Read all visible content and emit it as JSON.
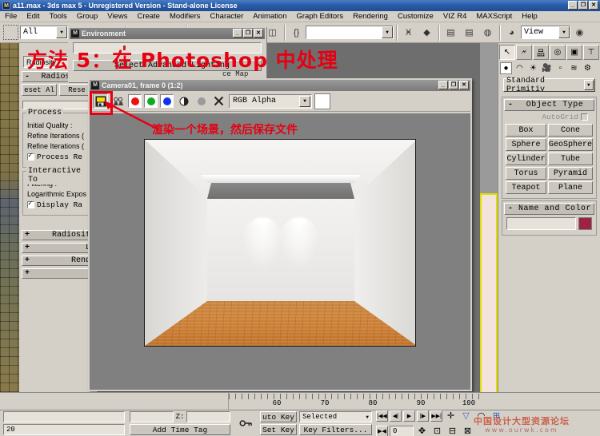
{
  "window": {
    "title": "a11.max - 3ds max 5 - Unregistered Version - Stand-alone License",
    "app_icon": "max-icon",
    "minimize": "_",
    "restore": "❐",
    "close": "✕"
  },
  "menu": {
    "items": [
      "File",
      "Edit",
      "Tools",
      "Group",
      "Views",
      "Create",
      "Modifiers",
      "Character",
      "Animation",
      "Graph Editors",
      "Rendering",
      "Customize",
      "VIZ R4",
      "MAXScript",
      "Help"
    ]
  },
  "toolbar": {
    "selection_filter": "All",
    "named_selection_sets": "",
    "view_dropdown": "View",
    "icons": [
      "undo-icon",
      "redo-icon",
      "select-link-icon",
      "unlink-icon",
      "bind-space-warp-icon",
      "select-object-icon",
      "select-by-name-icon",
      "select-region-icon",
      "move-icon",
      "rotate-icon",
      "scale-icon",
      "reference-coordinate-icon",
      "use-center-icon",
      "mirror-icon",
      "align-icon",
      "layer-manager-icon",
      "curve-editor-icon",
      "schematic-view-icon",
      "material-editor-icon",
      "render-scene-icon",
      "quick-render-icon"
    ]
  },
  "environment_dialog": {
    "title": "Environment",
    "icon": "max-icon",
    "minimize": "_",
    "restore": "❐",
    "close": "✕",
    "rollout": "Select Advanced Lighting",
    "rollout_toggle": "-",
    "stray_label": "ce Map"
  },
  "radiosity_panel": {
    "combo_value": "Radiosity",
    "rollout_title": "Radiosity",
    "rollout_toggle": "-",
    "buttons": [
      "eset Al",
      "Rese"
    ],
    "process_group": {
      "title": "Process",
      "rows": [
        "Initial Quality :",
        "Refine Iterations (",
        "Refine Iterations ("
      ],
      "checkbox_label": "Process Re",
      "checkbox_checked": true
    },
    "interactive_group": {
      "title": "Interactive To",
      "rows": [
        "Filtering :",
        "Logarithmic Expos"
      ],
      "checkbox_label": "Display Ra",
      "checkbox_checked": true
    },
    "collapsed_rollouts": [
      "Radiosit",
      "L",
      "Rend",
      ""
    ],
    "collapsed_toggle": "+"
  },
  "render_window": {
    "title": "Camera01, frame 0 (1:2)",
    "icon": "max-icon",
    "minimize": "_",
    "restore": "❐",
    "close": "✕",
    "toolbar": {
      "save_icon": "save-bitmap-icon",
      "clone_icon": "clone-rendered-frame-icon",
      "red_channel": "red-channel-icon",
      "green_channel": "green-channel-icon",
      "blue_channel": "blue-channel-icon",
      "mono_channel": "monochrome-icon",
      "alpha_channel": "alpha-channel-icon",
      "clear_icon": "clear-icon",
      "channel_dropdown": "RGB Alpha",
      "color_swatch": "#ffffff"
    },
    "colors": {
      "red": "#ee1111",
      "green": "#11aa22",
      "blue": "#1133ee"
    },
    "image": {
      "description": "rendered-interior-room",
      "floor_color": "#cf8a45",
      "wall_color": "#efeeec",
      "cove_color": "#7f7f7f",
      "spotlight_count": 2
    }
  },
  "command_panel": {
    "tabs": [
      "create-tab",
      "modify-tab",
      "hierarchy-tab",
      "motion-tab",
      "display-tab",
      "utilities-tab"
    ],
    "active_tab": 0,
    "subtabs": [
      "geometry-icon",
      "shapes-icon",
      "lights-icon",
      "cameras-icon",
      "helpers-icon",
      "space-warps-icon",
      "systems-icon"
    ],
    "category": "Standard Primitiv",
    "object_type": {
      "title": "Object Type",
      "toggle": "-",
      "autogrid_label": "AutoGrid",
      "autogrid_checked": false,
      "buttons": [
        "Box",
        "Cone",
        "Sphere",
        "GeoSphere",
        "Cylinder",
        "Tube",
        "Torus",
        "Pyramid",
        "Teapot",
        "Plane"
      ]
    },
    "name_and_color": {
      "title": "Name and Color",
      "toggle": "-",
      "name_value": "",
      "color": "#9e2244"
    }
  },
  "annotations": {
    "heading": "方法 5：在 Photoshop 中处理",
    "note": "渲染一个场景，然后保存文件",
    "color": "#e60012",
    "highlight_target": "save-bitmap-button"
  },
  "timeline": {
    "tick_labels": [
      "60",
      "70",
      "80",
      "90",
      "100"
    ],
    "tick_positions": [
      60,
      120,
      180,
      240,
      300
    ]
  },
  "statusbar": {
    "coord_z_label": "Z:",
    "coord_z_value": "",
    "lock_icon": "lock-selection-icon",
    "add_time_tag": "Add Time Tag",
    "frame_count": "20",
    "auto_key": "uto Key",
    "set_key": "Set Key",
    "key_mode": "Selected",
    "key_filters": "Key Filters...",
    "current_frame": "0",
    "playback_icons": [
      "go-to-start-icon",
      "previous-frame-icon",
      "play-animation-icon",
      "next-frame-icon",
      "go-to-end-icon"
    ],
    "key_mode_toggle": "key-mode-toggle-icon",
    "nav_icons": [
      "zoom-icon",
      "zoom-all-icon",
      "zoom-extents-icon",
      "field-of-view-icon",
      "pan-icon",
      "arc-rotate-icon",
      "min-max-toggle-icon"
    ]
  },
  "watermark": {
    "line1": "中国设计大型资源论坛",
    "line2": "www.ourwk.com"
  }
}
